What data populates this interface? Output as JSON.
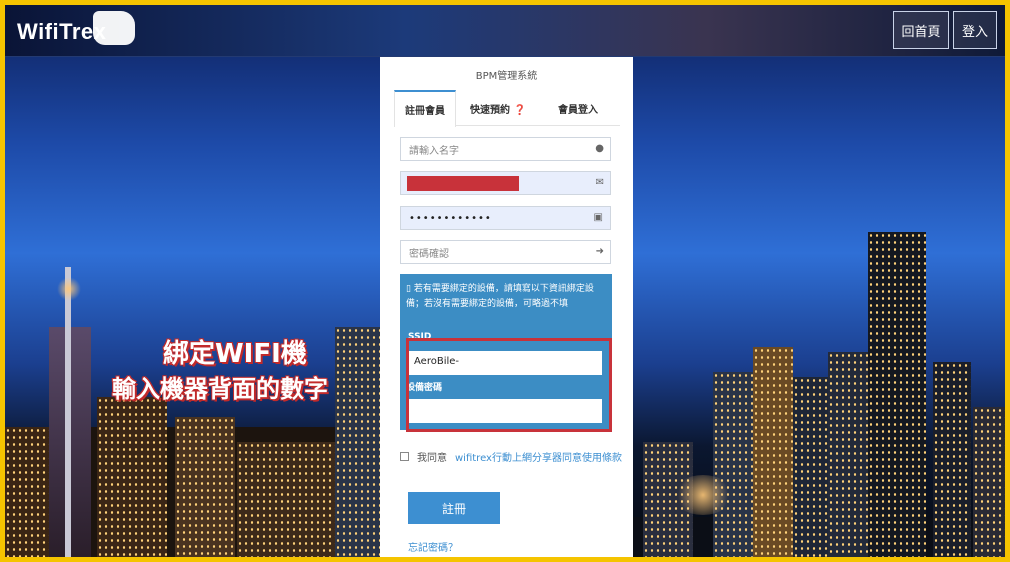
{
  "header": {
    "logo_text": "WifiTrex",
    "home_label": "回首頁",
    "login_label": "登入"
  },
  "overlay": {
    "line1": "綁定WIFI機",
    "line2": "輸入機器背面的數字"
  },
  "panel": {
    "title": "BPM管理系統",
    "tabs": [
      {
        "label": "註冊會員"
      },
      {
        "label": "快速預約 ❓"
      },
      {
        "label": "會員登入"
      }
    ],
    "fields": {
      "name_placeholder": "請輸入名字",
      "password_value": "••••••••••••",
      "confirm_placeholder": "密碼確認"
    },
    "info": {
      "message": "若有需要綁定的設備，請填寫以下資訊綁定設備；若沒有需要綁定的設備，可略過不填",
      "ssid_label": "SSID",
      "ssid_value": "AeroBile-",
      "device_password_label": "設備密碼"
    },
    "agree": {
      "prefix": "我同意",
      "link": "wifitrex行動上網分享器同意使用條款"
    },
    "submit_label": "註冊",
    "forgot_label": "忘記密碼？"
  },
  "colors": {
    "accent": "#3d8fd1",
    "highlight": "#c8323a",
    "frame": "#f5c400"
  },
  "icons": [
    "user-icon",
    "envelope-icon",
    "lock-icon",
    "sign-in-icon",
    "mobile-icon"
  ]
}
